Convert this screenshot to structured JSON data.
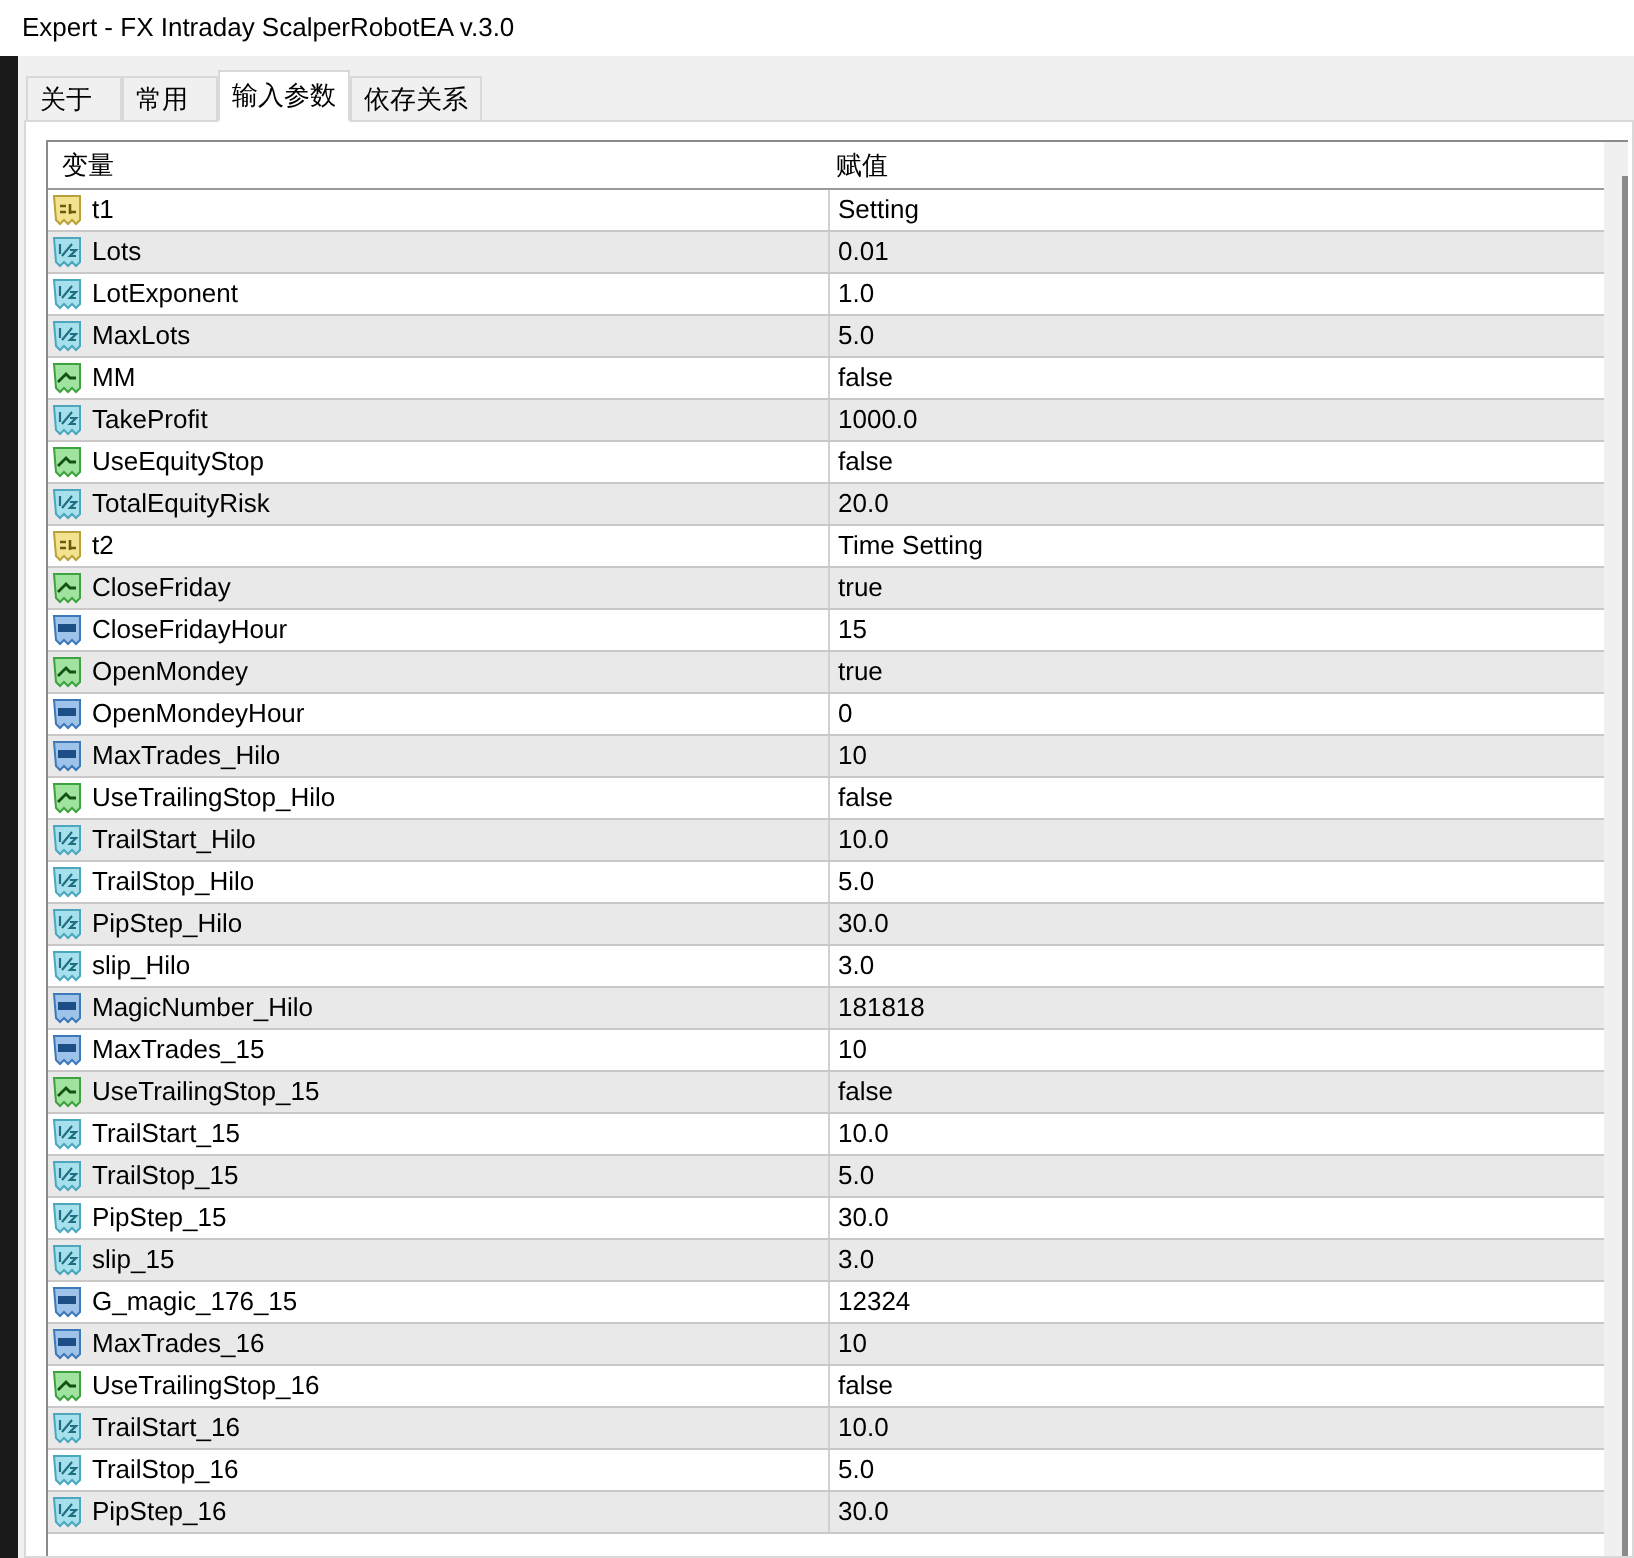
{
  "window": {
    "title": "Expert - FX Intraday ScalperRobotEA v.3.0"
  },
  "tabs": [
    {
      "label": "关于",
      "selected": false
    },
    {
      "label": "常用",
      "selected": false
    },
    {
      "label": "输入参数",
      "selected": true
    },
    {
      "label": "依存关系",
      "selected": false
    }
  ],
  "table": {
    "columns": [
      "变量",
      "赋值"
    ],
    "rows": [
      {
        "kind": "string",
        "name": "t1",
        "value": "Setting"
      },
      {
        "kind": "double",
        "name": "Lots",
        "value": "0.01"
      },
      {
        "kind": "double",
        "name": "LotExponent",
        "value": "1.0"
      },
      {
        "kind": "double",
        "name": "MaxLots",
        "value": "5.0"
      },
      {
        "kind": "bool",
        "name": "MM",
        "value": "false"
      },
      {
        "kind": "double",
        "name": "TakeProfit",
        "value": "1000.0"
      },
      {
        "kind": "bool",
        "name": "UseEquityStop",
        "value": "false"
      },
      {
        "kind": "double",
        "name": "TotalEquityRisk",
        "value": "20.0"
      },
      {
        "kind": "string",
        "name": "t2",
        "value": "Time Setting"
      },
      {
        "kind": "bool",
        "name": "CloseFriday",
        "value": "true"
      },
      {
        "kind": "int",
        "name": "CloseFridayHour",
        "value": "15"
      },
      {
        "kind": "bool",
        "name": "OpenMondey",
        "value": "true"
      },
      {
        "kind": "int",
        "name": "OpenMondeyHour",
        "value": "0"
      },
      {
        "kind": "int",
        "name": "MaxTrades_Hilo",
        "value": "10"
      },
      {
        "kind": "bool",
        "name": "UseTrailingStop_Hilo",
        "value": "false"
      },
      {
        "kind": "double",
        "name": "TrailStart_Hilo",
        "value": "10.0"
      },
      {
        "kind": "double",
        "name": "TrailStop_Hilo",
        "value": "5.0"
      },
      {
        "kind": "double",
        "name": "PipStep_Hilo",
        "value": "30.0"
      },
      {
        "kind": "double",
        "name": "slip_Hilo",
        "value": "3.0"
      },
      {
        "kind": "int",
        "name": "MagicNumber_Hilo",
        "value": "181818"
      },
      {
        "kind": "int",
        "name": "MaxTrades_15",
        "value": "10"
      },
      {
        "kind": "bool",
        "name": "UseTrailingStop_15",
        "value": "false"
      },
      {
        "kind": "double",
        "name": "TrailStart_15",
        "value": "10.0"
      },
      {
        "kind": "double",
        "name": "TrailStop_15",
        "value": "5.0"
      },
      {
        "kind": "double",
        "name": "PipStep_15",
        "value": "30.0"
      },
      {
        "kind": "double",
        "name": "slip_15",
        "value": "3.0"
      },
      {
        "kind": "int",
        "name": "G_magic_176_15",
        "value": "12324"
      },
      {
        "kind": "int",
        "name": "MaxTrades_16",
        "value": "10"
      },
      {
        "kind": "bool",
        "name": "UseTrailingStop_16",
        "value": "false"
      },
      {
        "kind": "double",
        "name": "TrailStart_16",
        "value": "10.0"
      },
      {
        "kind": "double",
        "name": "TrailStop_16",
        "value": "5.0"
      },
      {
        "kind": "double",
        "name": "PipStep_16",
        "value": "30.0"
      }
    ]
  }
}
